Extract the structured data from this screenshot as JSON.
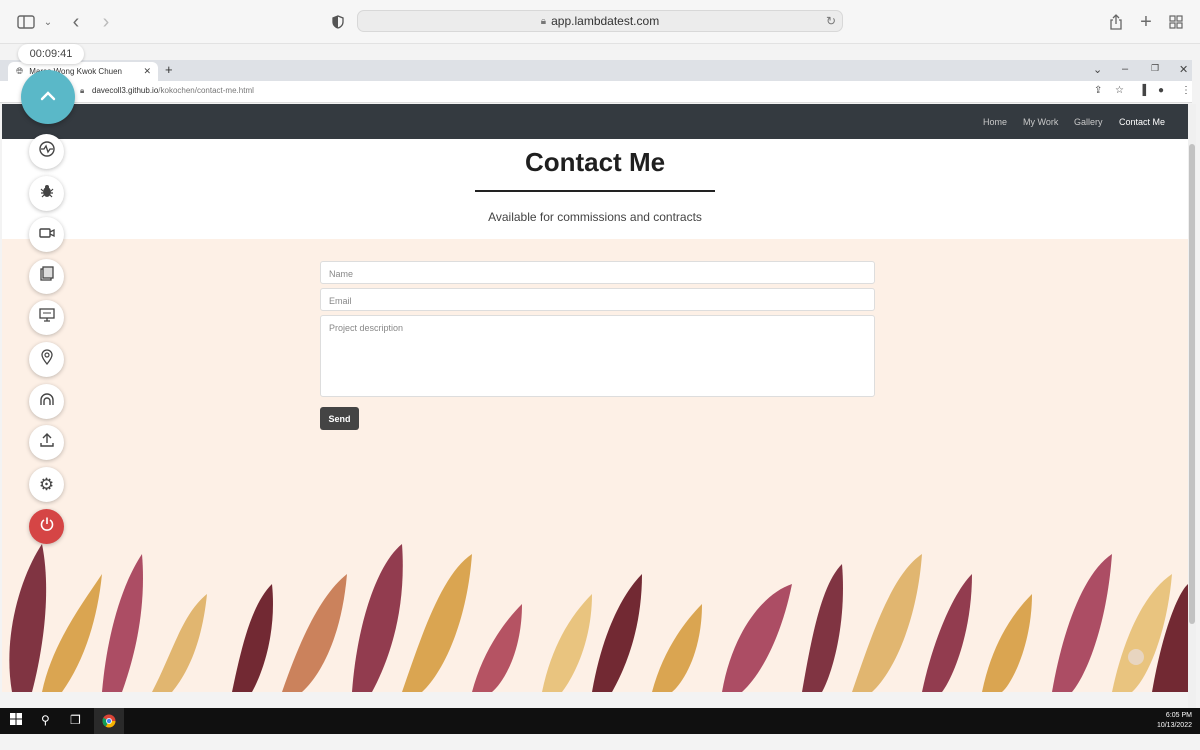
{
  "safari": {
    "url": "app.lambdatest.com",
    "timer": "00:09:41"
  },
  "chrome": {
    "tab_title": "Marco Wong Kwok Chuen",
    "address_host": "davecoll3.github.io",
    "address_path": "/kokochen/contact-me.html"
  },
  "site": {
    "nav": [
      "Home",
      "My Work",
      "Gallery",
      "Contact Me"
    ],
    "active_nav": "Contact Me",
    "title": "Contact Me",
    "subtitle": "Available for commissions and contracts",
    "form": {
      "name_placeholder": "Name",
      "email_placeholder": "Email",
      "description_placeholder": "Project description",
      "send_label": "Send"
    }
  },
  "taskbar": {
    "time": "6:05 PM",
    "date": "10/13/2022"
  },
  "colors": {
    "navbar": "#343a40",
    "page_background": "#fdf0e6",
    "lambdatest_accent": "#5ab8c8",
    "power_button": "#d54545"
  },
  "icons": {
    "lambdatest_toolbar": [
      "collapse-chevron-up-icon",
      "network-throttle-icon",
      "bug-icon",
      "video-camera-icon",
      "screenshot-gallery-icon",
      "resolution-monitor-icon",
      "location-pin-icon",
      "tunnel-icon",
      "upload-icon",
      "settings-gear-icon",
      "power-icon"
    ]
  }
}
